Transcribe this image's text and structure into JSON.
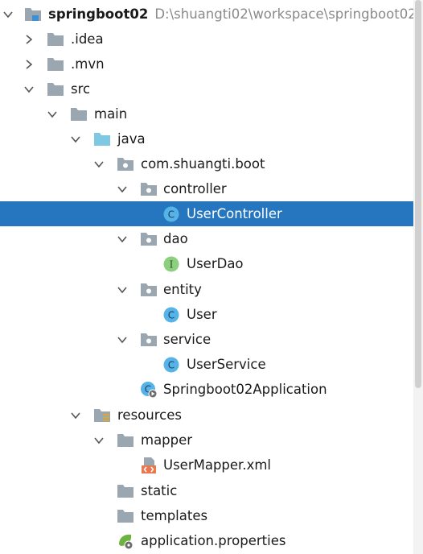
{
  "project": {
    "name": "springboot02",
    "path": "D:\\shuangti02\\workspace\\springboot02"
  },
  "nodes": {
    "idea": ".idea",
    "mvn": ".mvn",
    "src": "src",
    "main": "main",
    "java": "java",
    "pkg": "com.shuangti.boot",
    "controller": "controller",
    "user_controller": "UserController",
    "dao": "dao",
    "user_dao": "UserDao",
    "entity": "entity",
    "user": "User",
    "service": "service",
    "user_service": "UserService",
    "app": "Springboot02Application",
    "resources": "resources",
    "mapper": "mapper",
    "user_mapper": "UserMapper.xml",
    "static": "static",
    "templates": "templates",
    "app_props": "application.properties"
  },
  "icon_letters": {
    "class": "C",
    "interface": "I"
  },
  "colors": {
    "selection": "#2675bf",
    "folder": "#9aa7b0",
    "source_folder": "#7ec8e3",
    "class_icon": "#55b3e8",
    "interface_icon": "#8ccf7e"
  }
}
